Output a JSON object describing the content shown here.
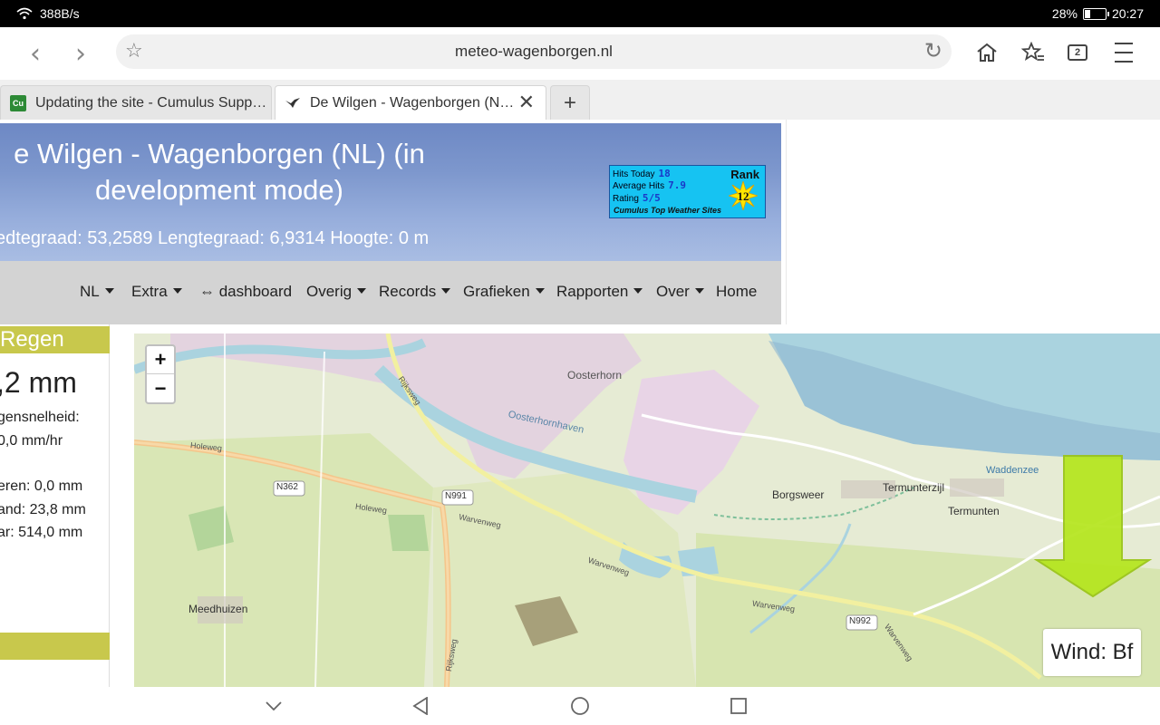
{
  "status": {
    "net_speed": "388B/s",
    "battery": "28%",
    "battery_level": 0.28,
    "time": "20:27"
  },
  "browser": {
    "url": "meteo-wagenborgen.nl",
    "tab_count": "2",
    "tabs": [
      {
        "favicon": "Cu",
        "title": "Updating the site - Cumulus Supp…"
      },
      {
        "favicon": "bird-icon",
        "title": "De Wilgen - Wagenborgen (N…"
      }
    ],
    "new_tab": "+"
  },
  "header": {
    "title_line1": "e Wilgen - Wagenborgen (NL) (in",
    "title_line2": "development mode)",
    "coords": "edtegraad: 53,2589 Lengtegraad: 6,9314 Hoogte: 0 m"
  },
  "badge": {
    "hits_today_label": "Hits Today",
    "hits_today": "18",
    "avg_hits_label": "Average Hits",
    "avg_hits": "7.9",
    "rating_label": "Rating",
    "rating": "5/5",
    "rank_label": "Rank",
    "rank": "12",
    "footer": "Cumulus Top Weather Sites"
  },
  "menu": [
    {
      "label": "NL",
      "dropdown": true
    },
    {
      "label": "Extra",
      "dropdown": true
    },
    {
      "label": "⇔ dashboard",
      "dropdown": false
    },
    {
      "label": "Overig",
      "dropdown": true
    },
    {
      "label": "Records",
      "dropdown": true
    },
    {
      "label": "Grafieken",
      "dropdown": true
    },
    {
      "label": "Rapporten",
      "dropdown": true
    },
    {
      "label": "Over",
      "dropdown": true
    },
    {
      "label": "Home",
      "dropdown": false
    }
  ],
  "rain": {
    "heading": "Regen",
    "value": ",2 mm",
    "rate_label": "gensnelheid:",
    "rate_value": "0,0 mm/hr",
    "line1": "eren: 0,0 mm",
    "line2": "and: 23,8 mm",
    "line3": "ar: 514,0 mm"
  },
  "map": {
    "zoom_in": "+",
    "zoom_out": "−",
    "wind_label": "Wind: Bf",
    "labels": {
      "oosterhorn": "Oosterhorn",
      "oosterhornhaven": "Oosterhornhaven",
      "borgsweer": "Borgsweer",
      "termunterzijl": "Termunterzijl",
      "termunten": "Termunten",
      "waddenzee": "Waddenzee",
      "meedhuizen": "Meedhuizen",
      "holeweg1": "Holeweg",
      "holeweg2": "Holeweg",
      "warvenweg1": "Warvenweg",
      "warvenweg2": "Warvenweg",
      "warvenweg3": "Warvenweg",
      "rijksweg1": "Rijksweg",
      "rijksweg2": "Rijksweg",
      "n362": "N362",
      "n991": "N991",
      "n992": "N992",
      "warvenweg4": "Warvenweg"
    }
  },
  "colors": {
    "header_blue": "#7d97cd",
    "rain_accent": "#c8c84c",
    "arrow_green": "#b5e61d",
    "sea": "#aad3df"
  }
}
